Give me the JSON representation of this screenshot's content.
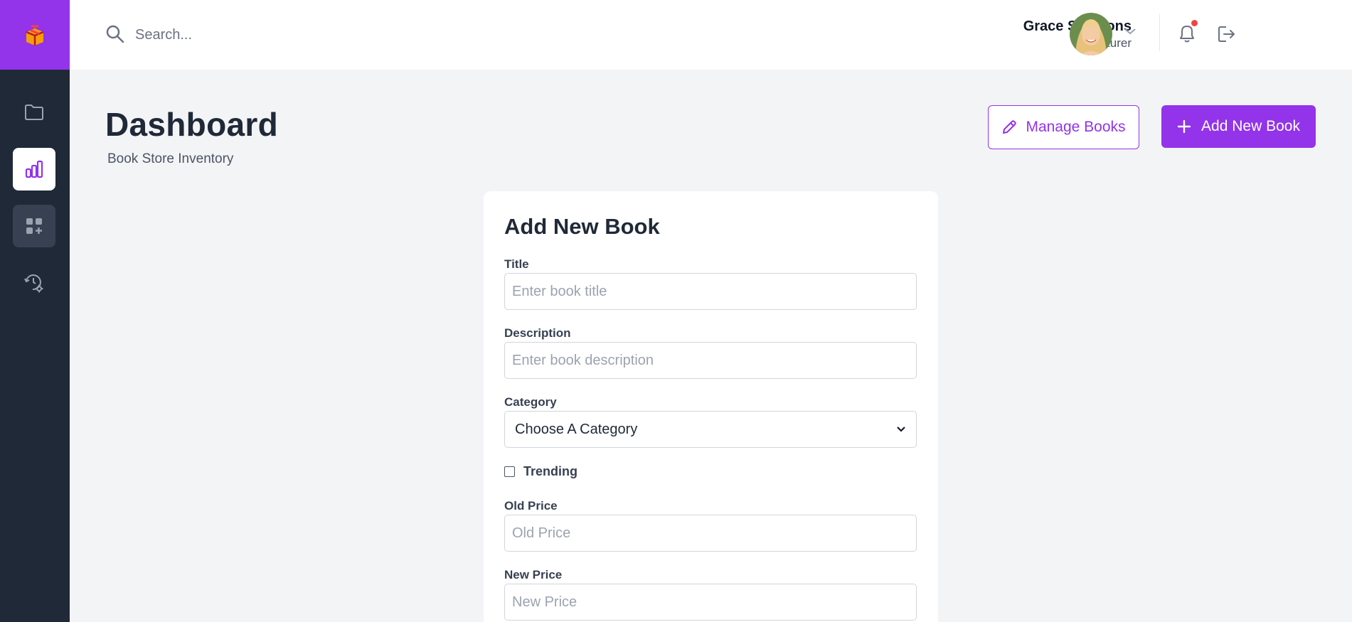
{
  "colors": {
    "accent": "#9333ea",
    "sidebar": "#1f2937",
    "notification": "#ef4444"
  },
  "header": {
    "search_placeholder": "Search...",
    "user_name": "Grace Simmons",
    "user_role": "Lecturer"
  },
  "sidebar": {
    "items": [
      {
        "icon": "folder-icon"
      },
      {
        "icon": "chart-bar-icon",
        "active": true
      },
      {
        "icon": "grid-add-icon"
      },
      {
        "icon": "history-settings-icon"
      }
    ]
  },
  "page": {
    "title": "Dashboard",
    "subtitle": "Book Store Inventory",
    "manage_label": "Manage Books",
    "add_label": "Add New Book"
  },
  "form": {
    "title": "Add New Book",
    "title_label": "Title",
    "title_placeholder": "Enter book title",
    "description_label": "Description",
    "description_placeholder": "Enter book description",
    "category_label": "Category",
    "category_value": "Choose A Category",
    "trending_label": "Trending",
    "old_price_label": "Old Price",
    "old_price_placeholder": "Old Price",
    "new_price_label": "New Price",
    "new_price_placeholder": "New Price"
  }
}
